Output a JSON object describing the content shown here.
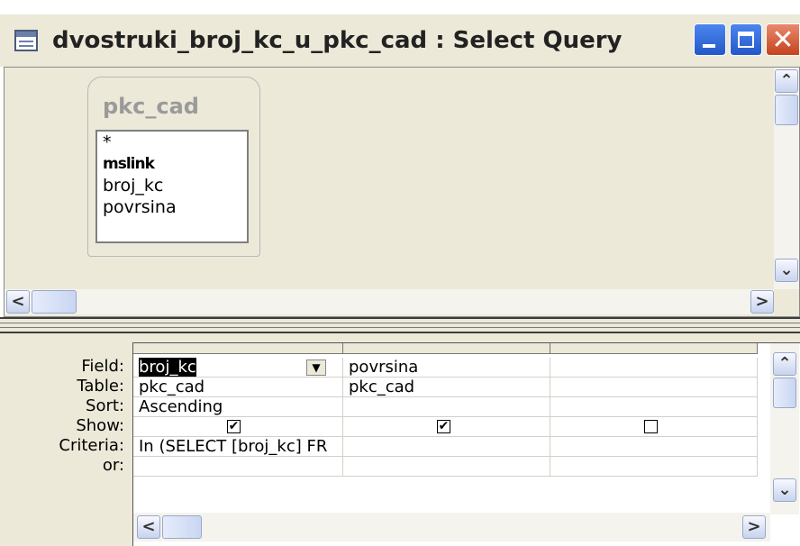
{
  "window": {
    "title": "dvostruki_broj_kc_u_pkc_cad : Select Query"
  },
  "table": {
    "name": "pkc_cad",
    "fields": [
      "*",
      "mslink",
      "broj_kc",
      "povrsina"
    ]
  },
  "grid": {
    "row_labels": [
      "Field:",
      "Table:",
      "Sort:",
      "Show:",
      "Criteria:",
      "or:"
    ],
    "columns": [
      {
        "field": "broj_kc",
        "table": "pkc_cad",
        "sort": "Ascending",
        "show": true,
        "criteria": "In (SELECT [broj_kc] FR"
      },
      {
        "field": "povrsina",
        "table": "pkc_cad",
        "sort": "",
        "show": true,
        "criteria": ""
      },
      {
        "field": "",
        "table": "",
        "sort": "",
        "show": false,
        "criteria": ""
      }
    ]
  },
  "icons": {
    "app": "query-window-icon",
    "minimize": "minimize-icon",
    "maximize": "maximize-icon",
    "close": "close-icon",
    "scroll_up": "arrow-up-icon",
    "scroll_down": "arrow-down-icon",
    "scroll_left": "arrow-left-icon",
    "scroll_right": "arrow-right-icon"
  },
  "glyphs": {
    "close": "✕",
    "up": "⌃",
    "down": "⌄",
    "left": "<",
    "right": ">",
    "dropdown": "▼",
    "check": "✔"
  }
}
